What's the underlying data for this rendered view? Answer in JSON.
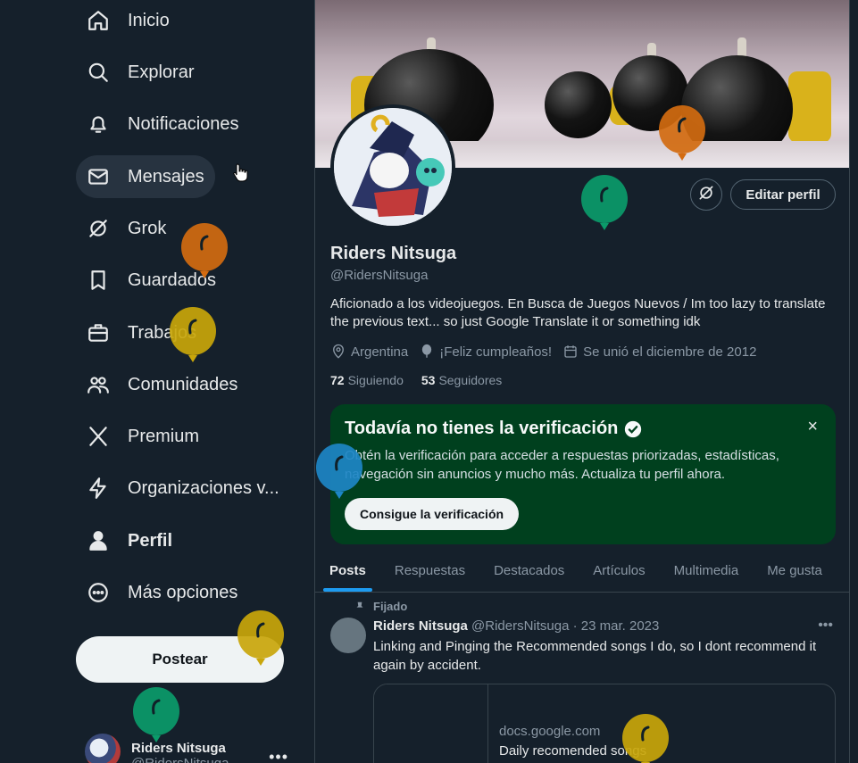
{
  "sidebar": {
    "items": [
      {
        "label": "Inicio",
        "icon": "home-icon"
      },
      {
        "label": "Explorar",
        "icon": "search-icon"
      },
      {
        "label": "Notificaciones",
        "icon": "bell-icon"
      },
      {
        "label": "Mensajes",
        "icon": "mail-icon"
      },
      {
        "label": "Grok",
        "icon": "grok-icon"
      },
      {
        "label": "Guardados",
        "icon": "bookmark-icon"
      },
      {
        "label": "Trabajos",
        "icon": "briefcase-icon"
      },
      {
        "label": "Comunidades",
        "icon": "people-icon"
      },
      {
        "label": "Premium",
        "icon": "x-logo-icon"
      },
      {
        "label": "Organizaciones v...",
        "icon": "lightning-icon"
      },
      {
        "label": "Perfil",
        "icon": "person-icon"
      },
      {
        "label": "Más opciones",
        "icon": "more-circle-icon"
      }
    ],
    "post_label": "Postear",
    "account": {
      "name": "Riders Nitsuga",
      "handle": "@RidersNitsuga"
    }
  },
  "profile": {
    "name": "Riders Nitsuga",
    "handle": "@RidersNitsuga",
    "edit_label": "Editar perfil",
    "bio": "Aficionado a los videojuegos. En Busca de Juegos Nuevos / Im too lazy to translate the previous text... so just Google Translate it or something idk",
    "location": "Argentina",
    "birthday": "¡Feliz cumpleaños!",
    "joined": "Se unió el diciembre de 2012",
    "following_count": "72",
    "following_label": "Siguiendo",
    "followers_count": "53",
    "followers_label": "Seguidores"
  },
  "verify": {
    "title": "Todavía no tienes la verificación",
    "text": "Obtén la verificación para acceder a respuestas priorizadas, estadísticas, navegación sin anuncios y mucho más. Actualiza tu perfil ahora.",
    "button": "Consigue la verificación",
    "close": "×"
  },
  "tabs": [
    "Posts",
    "Respuestas",
    "Destacados",
    "Artículos",
    "Multimedia",
    "Me gusta"
  ],
  "tweet": {
    "pinned_label": "Fijado",
    "name": "Riders Nitsuga",
    "meta": "@RidersNitsuga · 23 mar. 2023",
    "text": "Linking and Pinging the Recommended songs I do, so I dont recommend it again by accident.",
    "card_domain": "docs.google.com",
    "card_title": "Daily recomended songs"
  },
  "colors": {
    "background": "#15202b",
    "accent": "#1d9bf0",
    "verify_bg": "#00401e",
    "balloons": [
      "#0b9b6a",
      "#d36b10",
      "#c9a60a",
      "#1d86c6",
      "#c9a60a",
      "#0b9b6a",
      "#d36b10",
      "#c9a60a"
    ]
  }
}
